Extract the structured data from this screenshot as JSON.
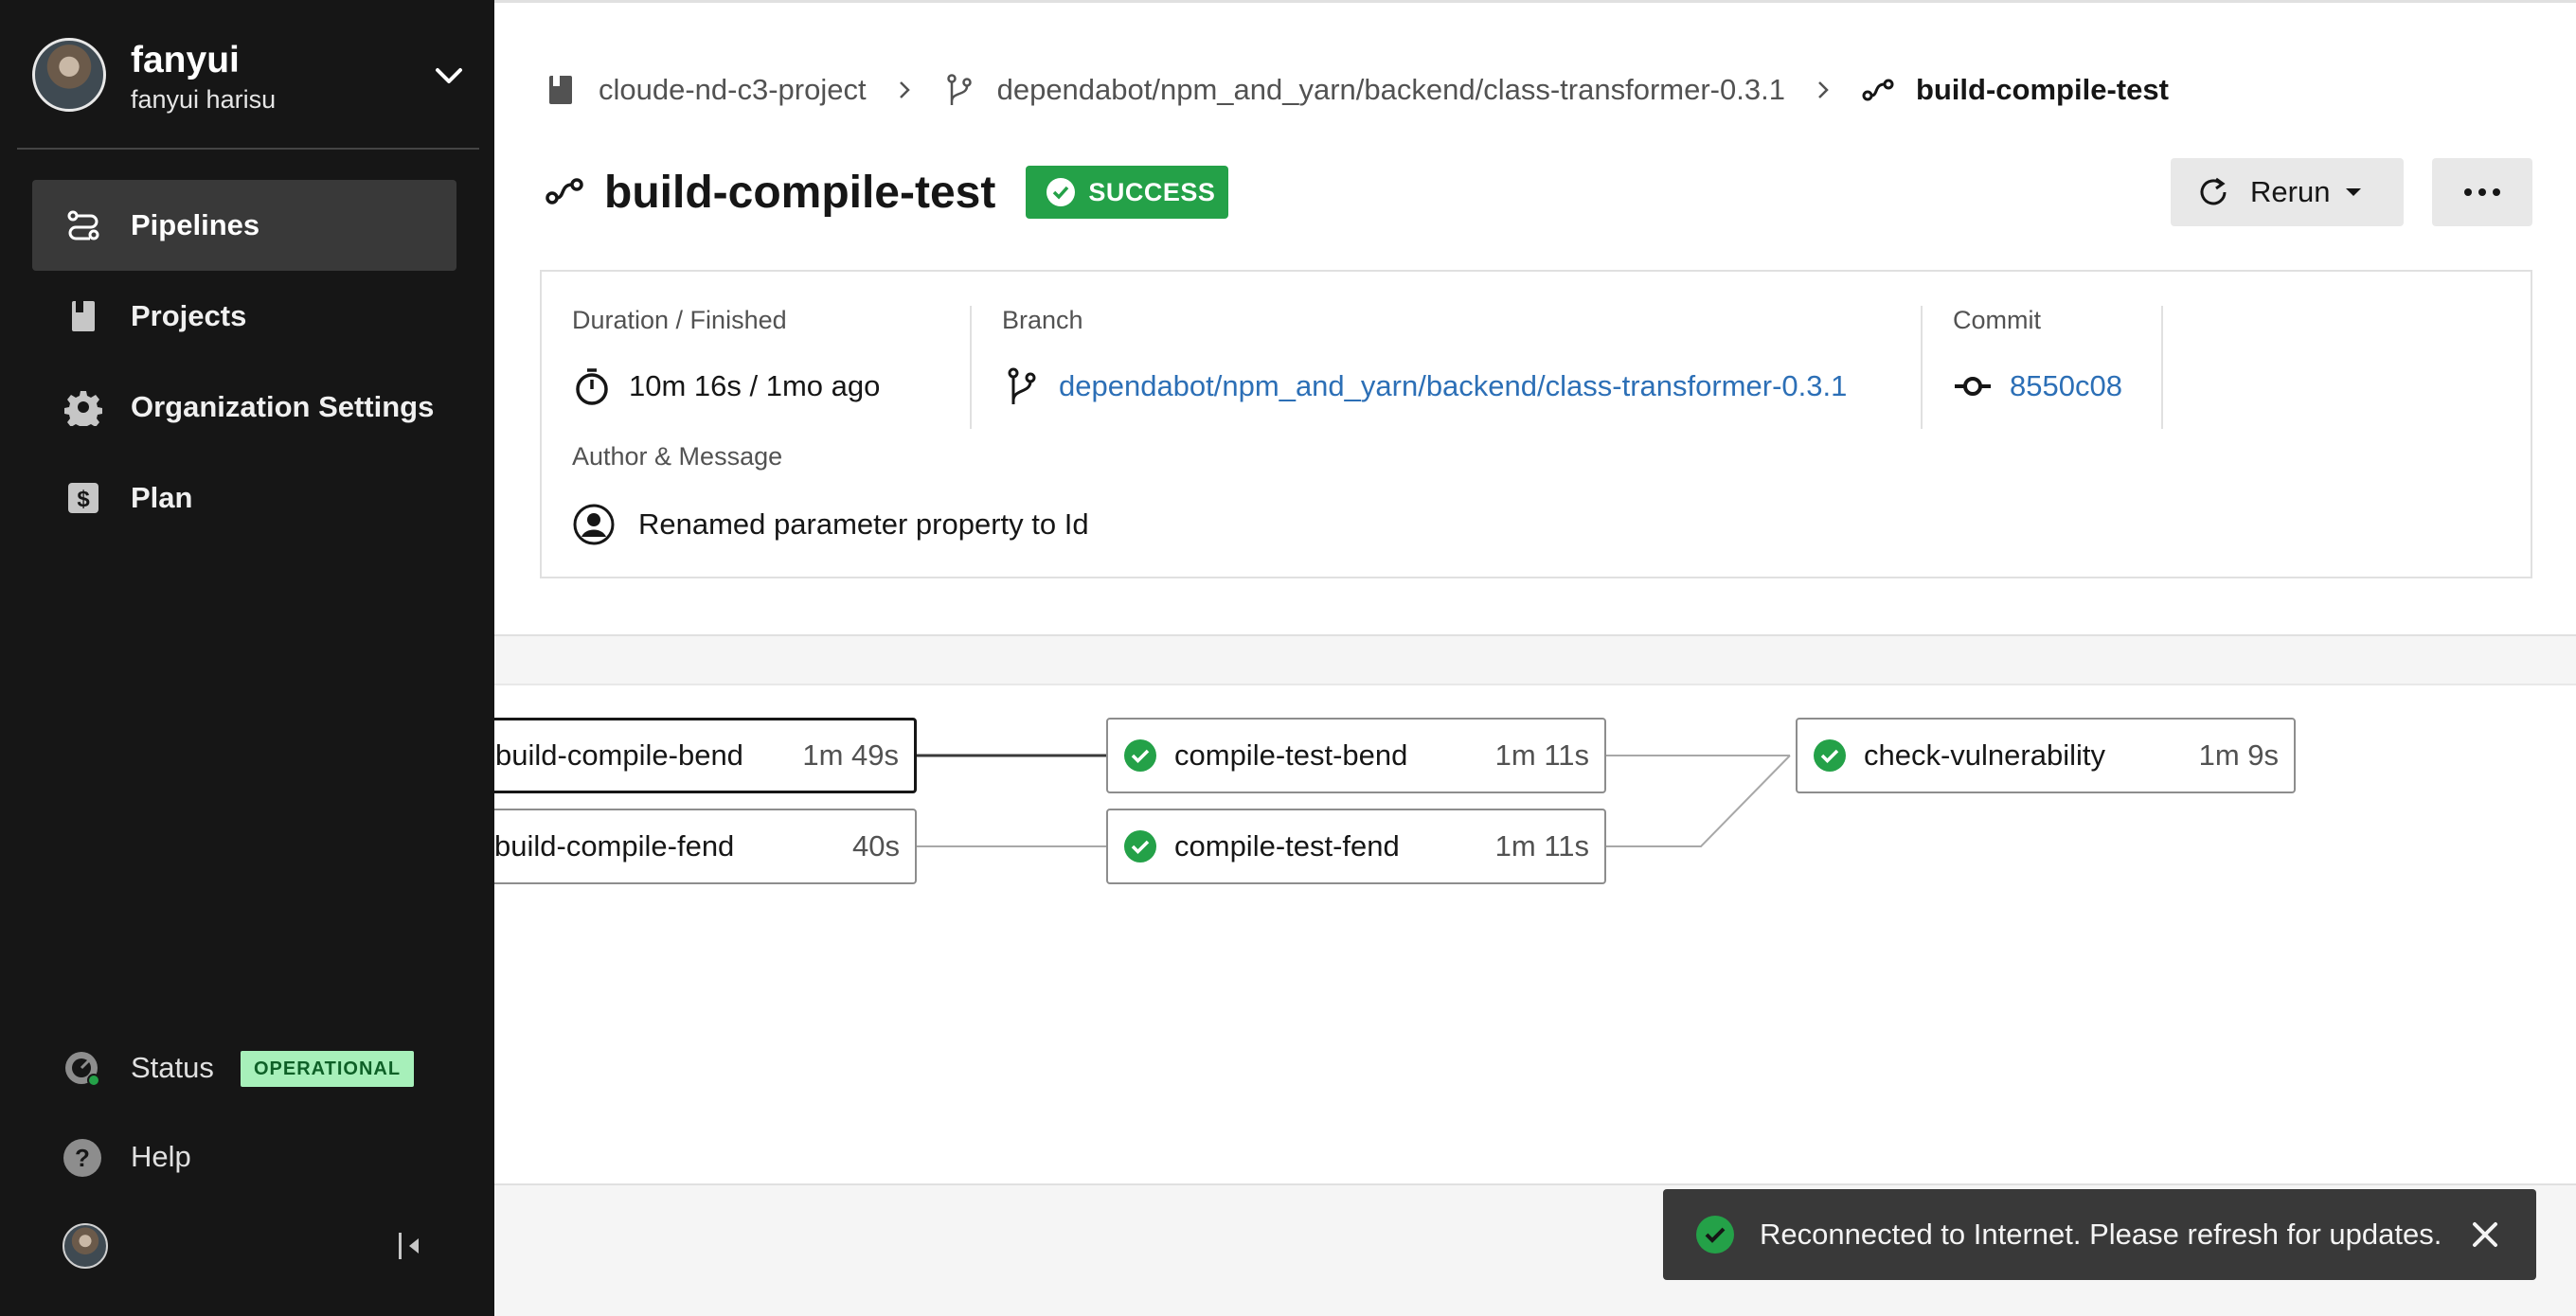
{
  "user": {
    "name": "fanyui",
    "full_name": "fanyui harisu"
  },
  "nav": {
    "items": [
      {
        "label": "Pipelines",
        "icon": "pipelines-icon",
        "active": true
      },
      {
        "label": "Projects",
        "icon": "projects-icon"
      },
      {
        "label": "Organization Settings",
        "icon": "gear-icon"
      },
      {
        "label": "Plan",
        "icon": "dollar-icon"
      }
    ],
    "status_label": "Status",
    "status_badge": "OPERATIONAL",
    "help_label": "Help"
  },
  "breadcrumb": {
    "project": "cloude-nd-c3-project",
    "branch": "dependabot/npm_and_yarn/backend/class-transformer-0.3.1",
    "workflow": "build-compile-test"
  },
  "header": {
    "title": "build-compile-test",
    "status": "SUCCESS",
    "rerun_label": "Rerun"
  },
  "info": {
    "duration_label": "Duration / Finished",
    "duration_value": "10m 16s / 1mo ago",
    "branch_label": "Branch",
    "branch_value": "dependabot/npm_and_yarn/backend/class-transformer-0.3.1",
    "commit_label": "Commit",
    "commit_value": "8550c08",
    "author_label": "Author & Message",
    "author_message": "Renamed parameter property to Id"
  },
  "jobs": [
    {
      "name": "build-compile-bend",
      "duration": "1m 49s",
      "status": "success"
    },
    {
      "name": "build-compile-fend",
      "duration": "40s",
      "status": "success"
    },
    {
      "name": "compile-test-bend",
      "duration": "1m 11s",
      "status": "success"
    },
    {
      "name": "compile-test-fend",
      "duration": "1m 11s",
      "status": "success"
    },
    {
      "name": "check-vulnerability",
      "duration": "1m 9s",
      "status": "success"
    }
  ],
  "toast": {
    "message": "Reconnected to Internet. Please refresh for updates."
  },
  "colors": {
    "success": "#24a148",
    "sidebar": "#161616",
    "link": "#2c6fb6",
    "toast": "#393939"
  }
}
